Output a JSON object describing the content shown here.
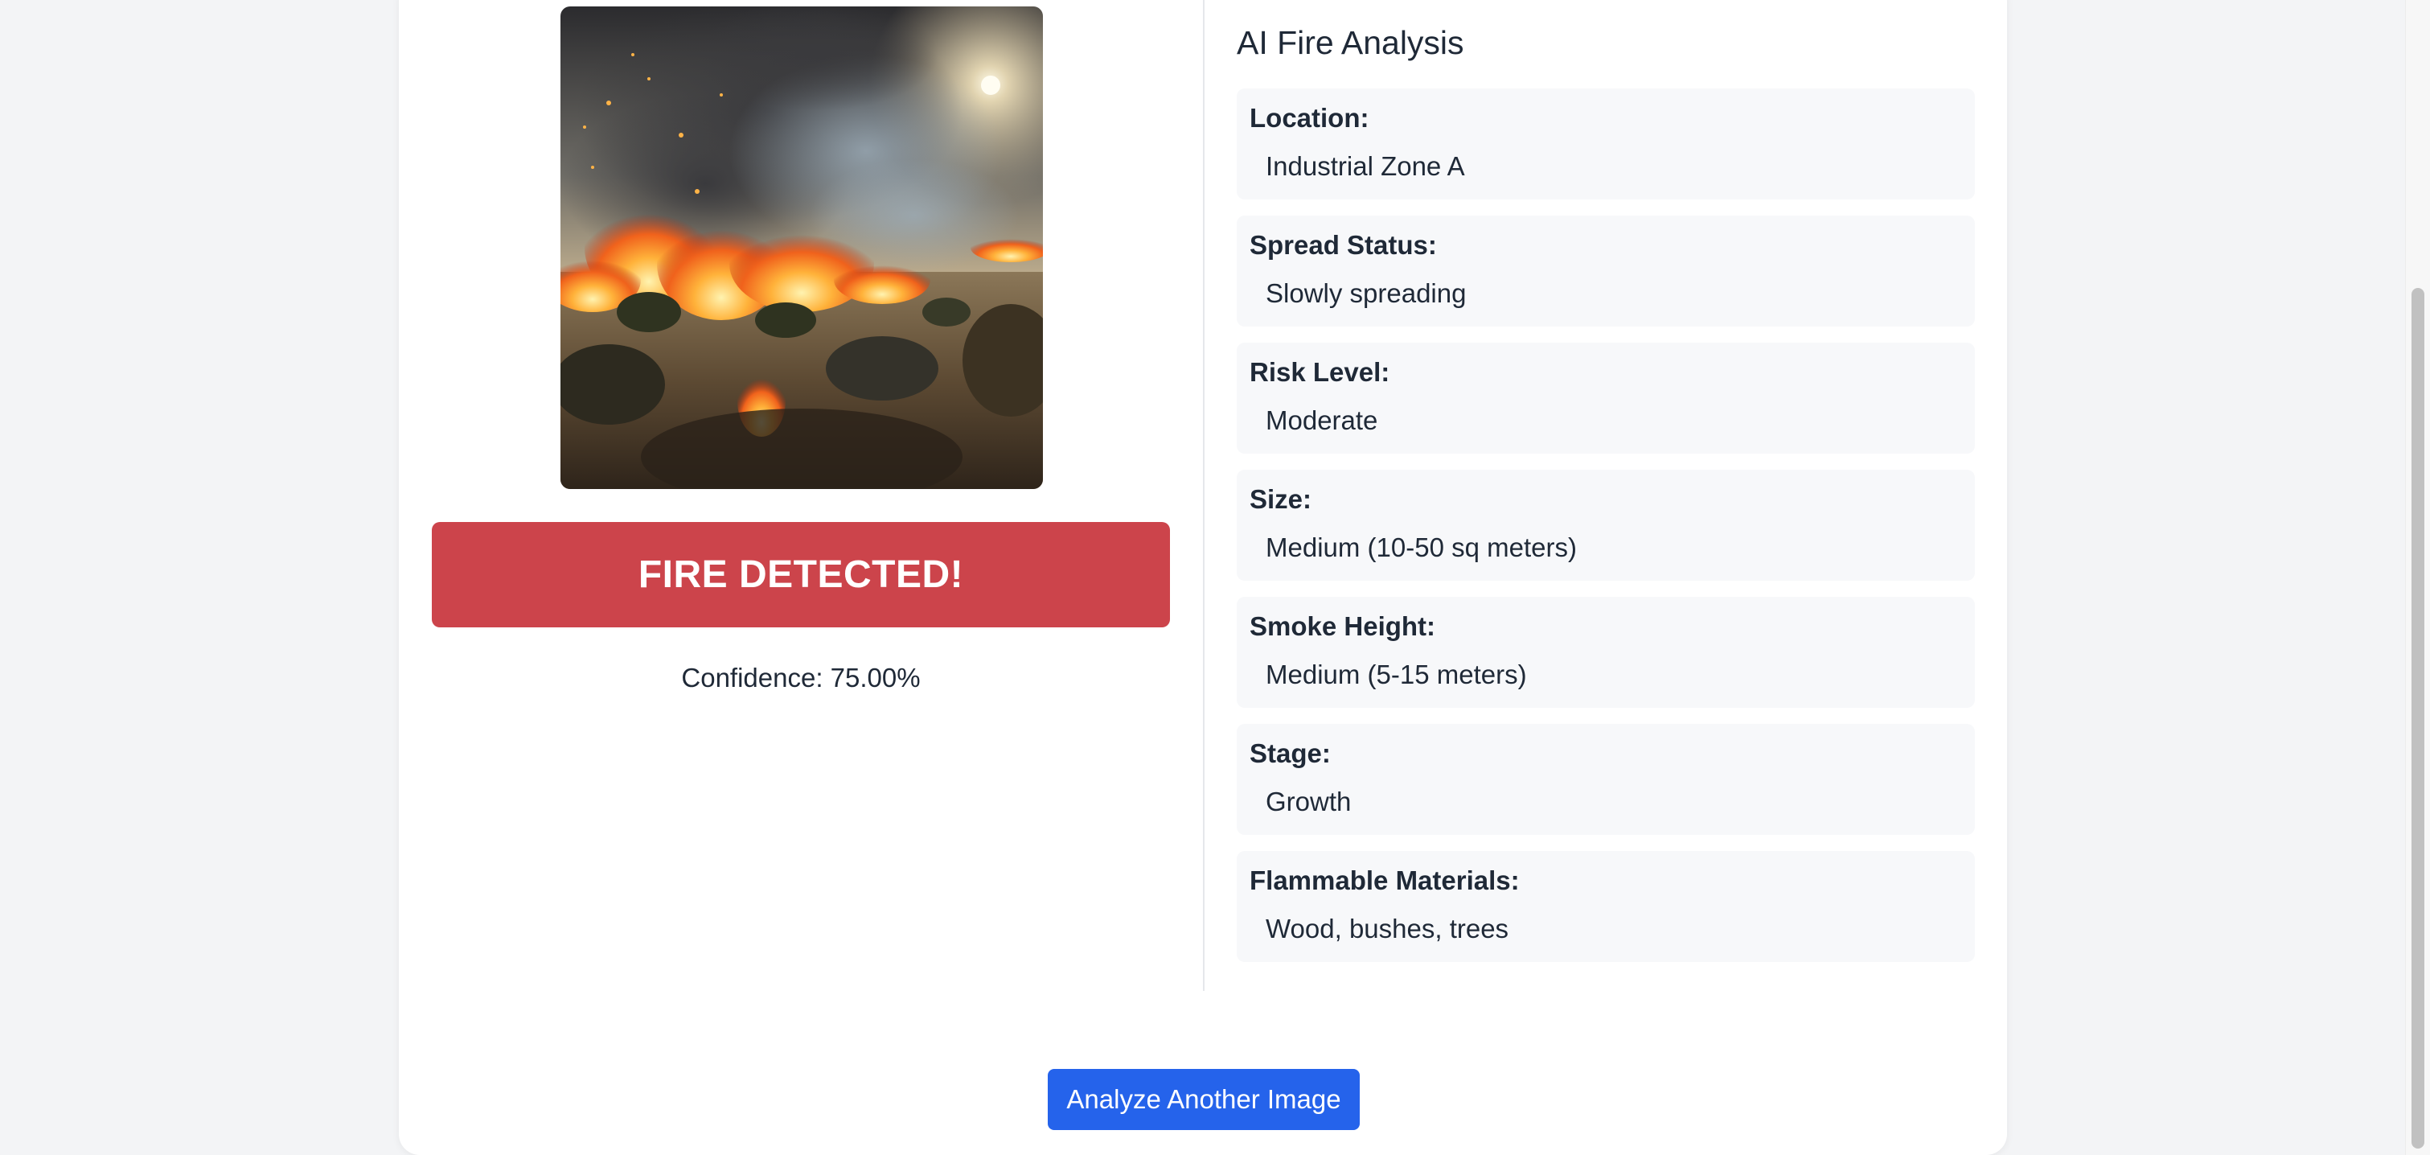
{
  "image": {
    "subject": "wildfire in grassland"
  },
  "detection": {
    "alert": "FIRE DETECTED!",
    "confidence": "Confidence: 75.00%",
    "alert_color": "#cc444b"
  },
  "analysis": {
    "title": "AI Fire Analysis",
    "items": [
      {
        "label": "Location:",
        "value": "Industrial Zone A"
      },
      {
        "label": "Spread Status:",
        "value": "Slowly spreading"
      },
      {
        "label": "Risk Level:",
        "value": "Moderate"
      },
      {
        "label": "Size:",
        "value": "Medium (10-50 sq meters)"
      },
      {
        "label": "Smoke Height:",
        "value": "Medium (5-15 meters)"
      },
      {
        "label": "Stage:",
        "value": "Growth"
      },
      {
        "label": "Flammable Materials:",
        "value": "Wood, bushes, trees"
      }
    ]
  },
  "actions": {
    "analyze_another": "Analyze Another Image",
    "button_color": "#2563eb"
  }
}
